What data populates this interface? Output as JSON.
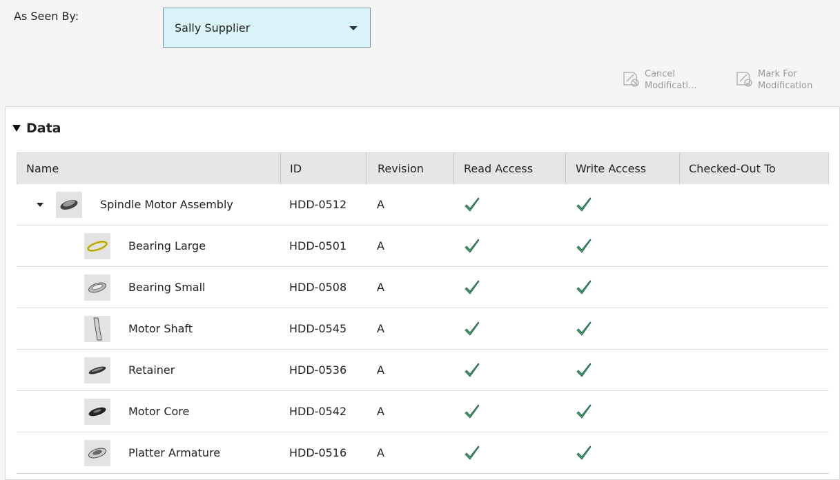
{
  "header": {
    "as_seen_by_label": "As Seen By:",
    "selected_user": "Sally Supplier"
  },
  "commands": {
    "cancel_line1": "Cancel",
    "cancel_line2": "Modificati...",
    "mark_line1": "Mark For",
    "mark_line2": "Modification"
  },
  "section": {
    "title": "Data"
  },
  "table": {
    "columns": [
      "Name",
      "ID",
      "Revision",
      "Read Access",
      "Write Access",
      "Checked-Out To"
    ],
    "rows": [
      {
        "name": "Spindle Motor Assembly",
        "id": "HDD-0512",
        "revision": "A",
        "read": true,
        "write": true,
        "checked_out_to": "",
        "level": 0,
        "thumb": "spindle-motor-icon"
      },
      {
        "name": "Bearing Large",
        "id": "HDD-0501",
        "revision": "A",
        "read": true,
        "write": true,
        "checked_out_to": "",
        "level": 1,
        "thumb": "bearing-large-icon"
      },
      {
        "name": "Bearing Small",
        "id": "HDD-0508",
        "revision": "A",
        "read": true,
        "write": true,
        "checked_out_to": "",
        "level": 1,
        "thumb": "bearing-small-icon"
      },
      {
        "name": "Motor Shaft",
        "id": "HDD-0545",
        "revision": "A",
        "read": true,
        "write": true,
        "checked_out_to": "",
        "level": 1,
        "thumb": "motor-shaft-icon"
      },
      {
        "name": "Retainer",
        "id": "HDD-0536",
        "revision": "A",
        "read": true,
        "write": true,
        "checked_out_to": "",
        "level": 1,
        "thumb": "retainer-icon"
      },
      {
        "name": "Motor Core",
        "id": "HDD-0542",
        "revision": "A",
        "read": true,
        "write": true,
        "checked_out_to": "",
        "level": 1,
        "thumb": "motor-core-icon"
      },
      {
        "name": "Platter Armature",
        "id": "HDD-0516",
        "revision": "A",
        "read": true,
        "write": true,
        "checked_out_to": "",
        "level": 1,
        "thumb": "platter-armature-icon"
      }
    ]
  },
  "colors": {
    "check": "#3f9e6e",
    "select_bg": "#d9f3f8"
  }
}
